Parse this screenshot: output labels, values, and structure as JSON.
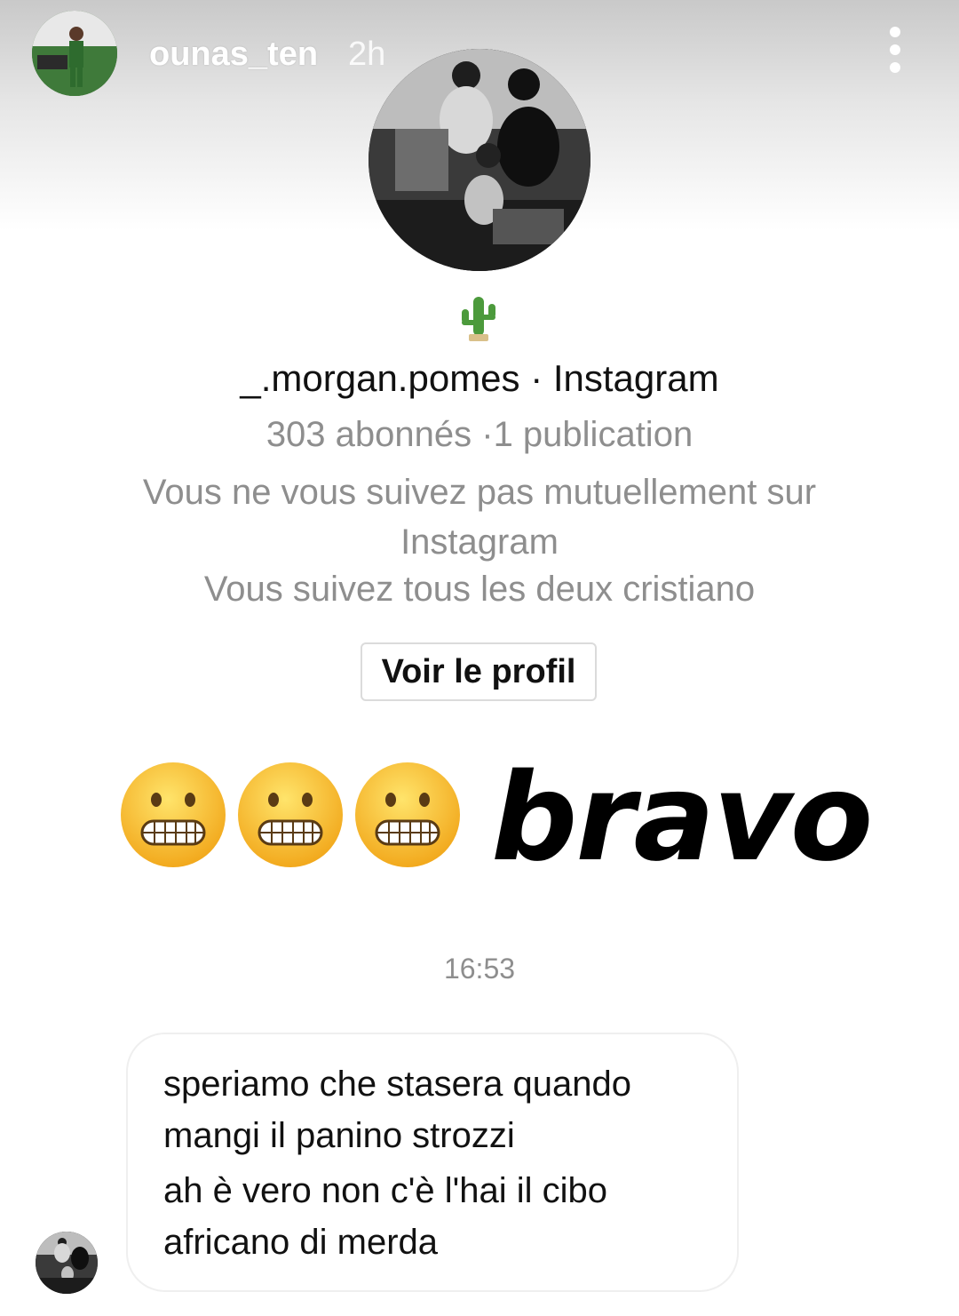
{
  "story": {
    "username": "ounas_ten",
    "time": "2h"
  },
  "profile": {
    "name_line": "_.morgan.pomes · Instagram",
    "stats": "303 abonnés ·1 publication",
    "mutual": "Vous ne vous suivez pas mutuellement sur Instagram",
    "common": "Vous suivez tous les deux cristiano",
    "view_button": "Voir le profil"
  },
  "sticker": {
    "emoji_icon": "grimacing-face-icon",
    "emoji_count": 3,
    "text": "bravo"
  },
  "chat": {
    "timestamp": "16:53",
    "message_lines": [
      "speriamo che stasera quando",
      "mangi il panino strozzi",
      "ah è vero non c'è l'hai il cibo",
      "africano di merda"
    ]
  },
  "colors": {
    "secondary_text": "#8e8e8e",
    "button_border": "#dbdbdb",
    "emoji_yellow": "#f7c52b"
  }
}
